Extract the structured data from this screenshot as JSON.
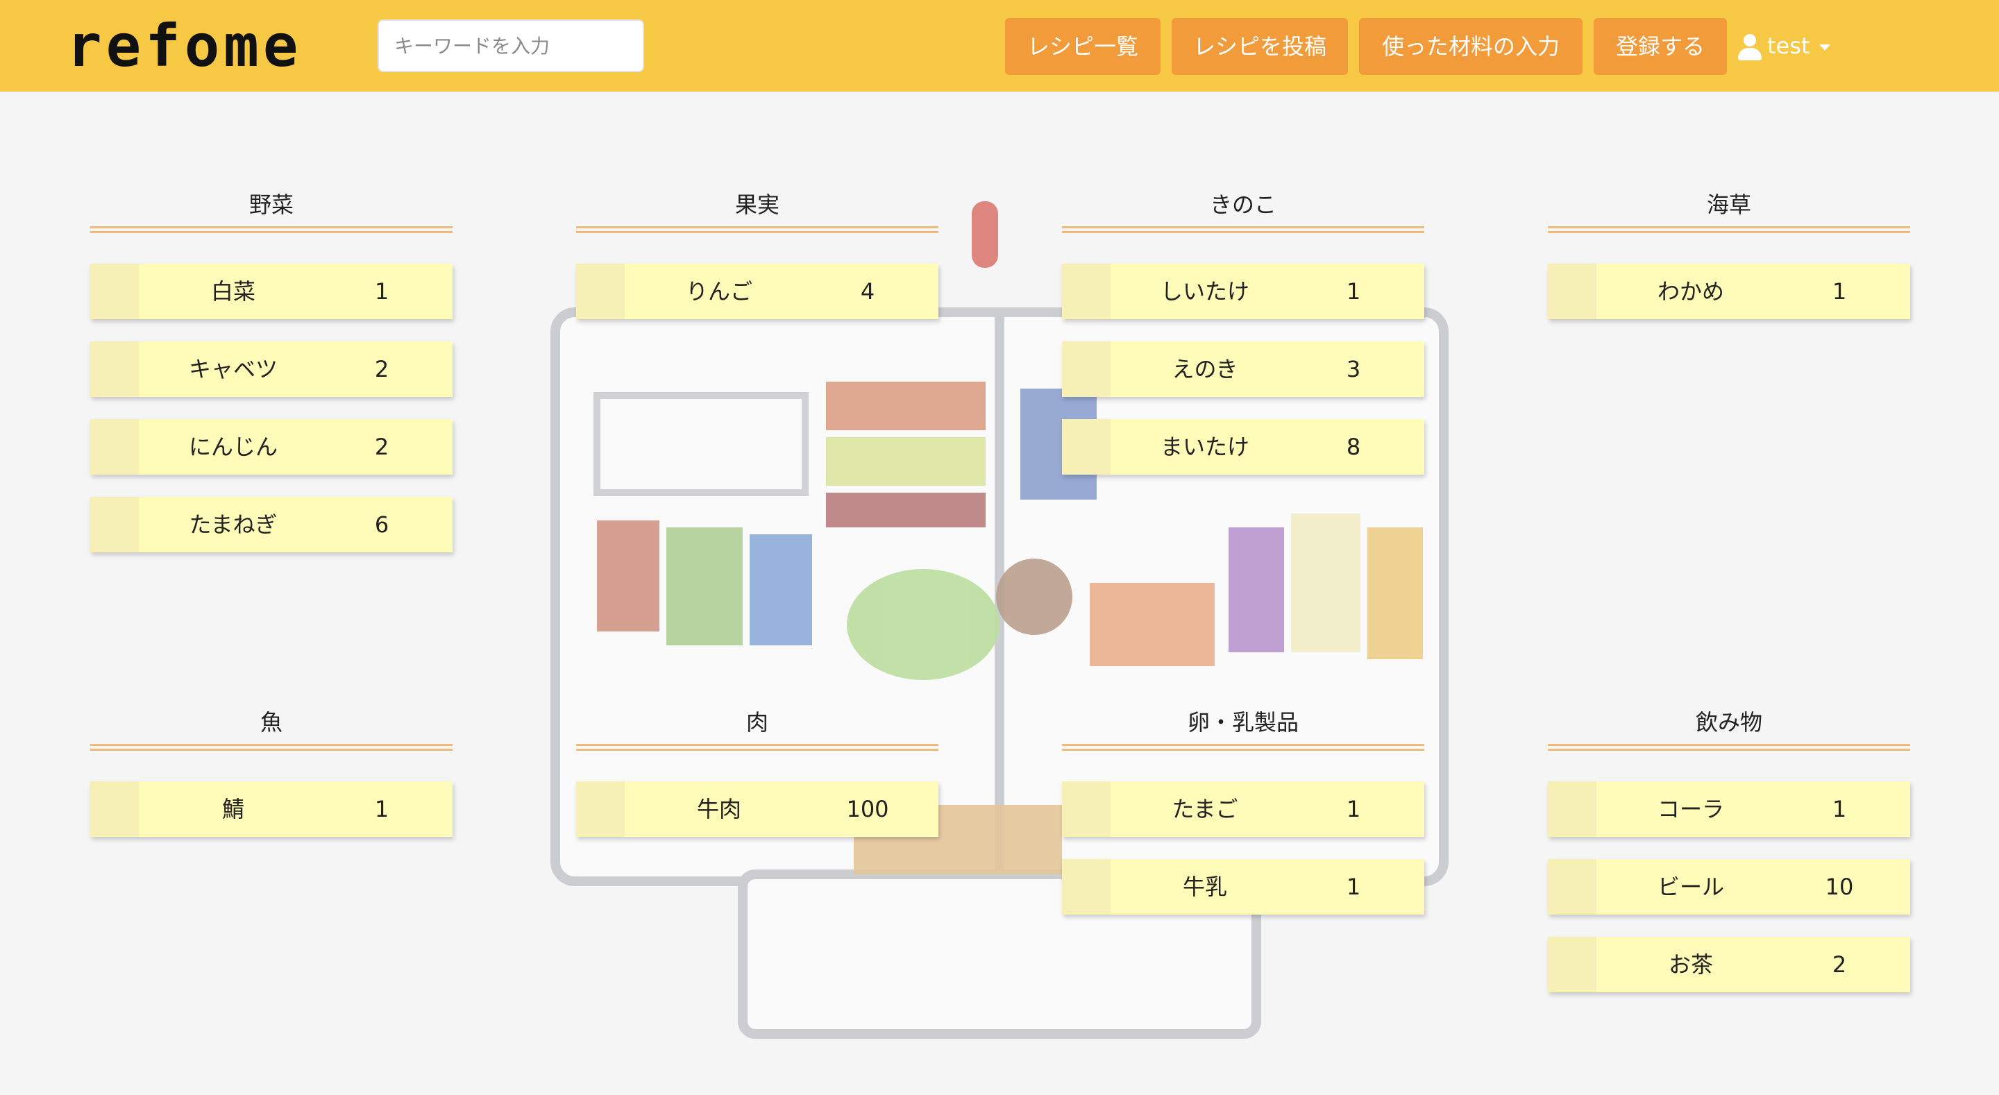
{
  "header": {
    "logo": "refome",
    "search_placeholder": "キーワードを入力",
    "nav": [
      "レシピ一覧",
      "レシピを投稿",
      "使った材料の入力",
      "登録する"
    ],
    "user": "test"
  },
  "categories": [
    {
      "title": "野菜",
      "items": [
        {
          "name": "白菜",
          "qty": "1"
        },
        {
          "name": "キャベツ",
          "qty": "2"
        },
        {
          "name": "にんじん",
          "qty": "2"
        },
        {
          "name": "たまねぎ",
          "qty": "6"
        }
      ]
    },
    {
      "title": "果実",
      "items": [
        {
          "name": "りんご",
          "qty": "4"
        }
      ]
    },
    {
      "title": "きのこ",
      "items": [
        {
          "name": "しいたけ",
          "qty": "1"
        },
        {
          "name": "えのき",
          "qty": "3"
        },
        {
          "name": "まいたけ",
          "qty": "8"
        }
      ]
    },
    {
      "title": "海草",
      "items": [
        {
          "name": "わかめ",
          "qty": "1"
        }
      ]
    },
    {
      "title": "魚",
      "items": [
        {
          "name": "鯖",
          "qty": "1"
        }
      ]
    },
    {
      "title": "肉",
      "items": [
        {
          "name": "牛肉",
          "qty": "100"
        }
      ]
    },
    {
      "title": "卵・乳製品",
      "items": [
        {
          "name": "たまご",
          "qty": "1"
        },
        {
          "name": "牛乳",
          "qty": "1"
        }
      ]
    },
    {
      "title": "飲み物",
      "items": [
        {
          "name": "コーラ",
          "qty": "1"
        },
        {
          "name": "ビール",
          "qty": "10"
        },
        {
          "name": "お茶",
          "qty": "2"
        }
      ]
    }
  ],
  "colors": {
    "header": "#f7c844",
    "button": "#f29b3a",
    "item": "#fffbb8",
    "rule": "#f2b97a"
  }
}
